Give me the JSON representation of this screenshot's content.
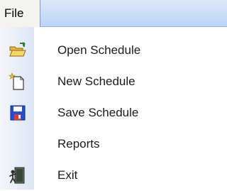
{
  "menubar": {
    "file_label": "File"
  },
  "menu": {
    "items": [
      {
        "label": "Open Schedule",
        "icon": "open-folder-icon"
      },
      {
        "label": "New Schedule",
        "icon": "new-document-icon"
      },
      {
        "label": "Save Schedule",
        "icon": "save-disk-icon"
      },
      {
        "label": "Reports",
        "icon": ""
      },
      {
        "label": "Exit",
        "icon": "exit-door-icon"
      }
    ]
  }
}
